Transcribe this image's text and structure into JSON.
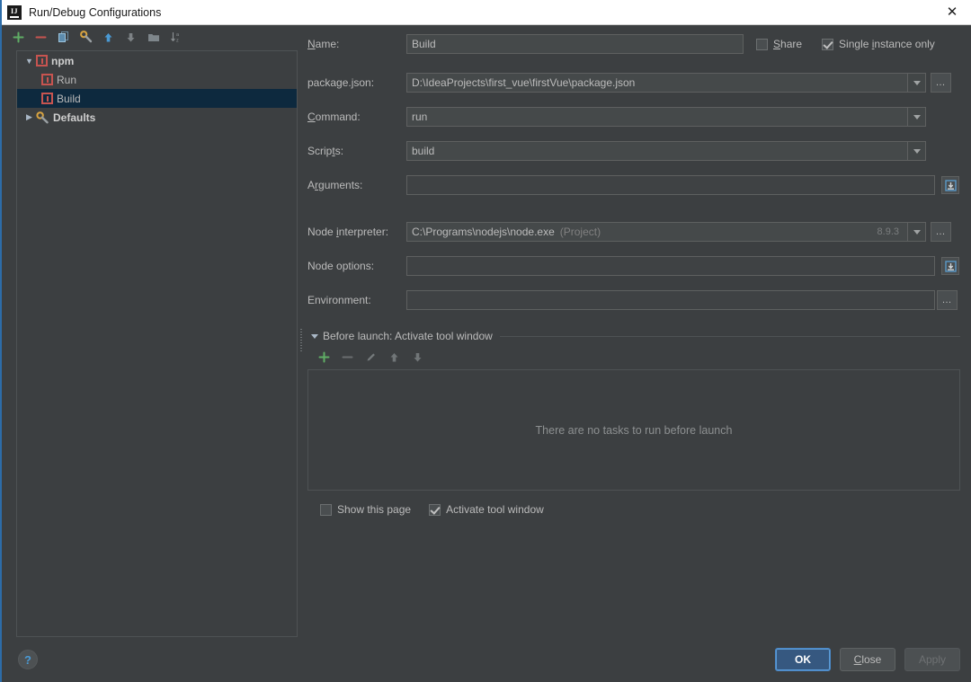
{
  "window": {
    "title": "Run/Debug Configurations",
    "logo_text": "IJ",
    "close_label": "✕"
  },
  "tree_toolbar": {
    "icons": [
      {
        "name": "add-configuration-icon",
        "label": "+"
      },
      {
        "name": "remove-configuration-icon",
        "label": "−"
      },
      {
        "name": "copy-configuration-icon",
        "label": "copy"
      },
      {
        "name": "edit-defaults-icon",
        "label": "wrench"
      },
      {
        "name": "move-up-icon",
        "label": "↑"
      },
      {
        "name": "move-down-icon",
        "label": "↓"
      },
      {
        "name": "folder-icon",
        "label": "folder"
      },
      {
        "name": "sort-alphabetically-icon",
        "label": "sort"
      }
    ]
  },
  "tree": {
    "nodes": [
      {
        "label": "npm",
        "type": "group",
        "expanded": true,
        "selected": false,
        "icon": "npm-icon",
        "indent": 0
      },
      {
        "label": "Run",
        "type": "config",
        "selected": false,
        "icon": "npm-icon",
        "indent": 1
      },
      {
        "label": "Build",
        "type": "config",
        "selected": true,
        "icon": "npm-icon",
        "indent": 1
      },
      {
        "label": "Defaults",
        "type": "group",
        "expanded": false,
        "selected": false,
        "icon": "wrench-icon",
        "indent": 0
      }
    ]
  },
  "form": {
    "name_label": "Name:",
    "name_mnemonic": "N",
    "name_value": "Build",
    "share_label": "Share",
    "share_checked": false,
    "single_instance_label": "Single instance only",
    "single_instance_checked": true,
    "package_json_label": "package.json:",
    "package_json_value": "D:\\IdeaProjects\\first_vue\\firstVue\\package.json",
    "command_label": "Command:",
    "command_value": "run",
    "scripts_label": "Scripts:",
    "scripts_value": "build",
    "arguments_label": "Arguments:",
    "arguments_value": "",
    "node_interpreter_label": "Node interpreter:",
    "node_interpreter_value": "C:\\Programs\\nodejs\\node.exe",
    "node_interpreter_scope": "(Project)",
    "node_interpreter_version": "8.9.3",
    "node_options_label": "Node options:",
    "node_options_value": "",
    "environment_label": "Environment:",
    "environment_value": "",
    "browse_label": "…"
  },
  "before_launch": {
    "header": "Before launch: Activate tool window",
    "toolbar": [
      {
        "name": "add-task-icon",
        "label": "+",
        "enabled": true
      },
      {
        "name": "remove-task-icon",
        "label": "−",
        "enabled": false
      },
      {
        "name": "edit-task-icon",
        "label": "pencil",
        "enabled": false
      },
      {
        "name": "move-task-up-icon",
        "label": "↑",
        "enabled": false
      },
      {
        "name": "move-task-down-icon",
        "label": "↓",
        "enabled": false
      }
    ],
    "empty_text": "There are no tasks to run before launch",
    "show_page_label": "Show this page",
    "show_page_checked": false,
    "activate_window_label": "Activate tool window",
    "activate_window_checked": true
  },
  "footer": {
    "help_label": "?",
    "ok_label": "OK",
    "close_label": "Close",
    "apply_label": "Apply"
  },
  "colors": {
    "background": "#3c3f41",
    "selection": "#0d293e",
    "accent": "#365880",
    "npm_red": "#c75450",
    "link_blue": "#4a9ad4"
  }
}
